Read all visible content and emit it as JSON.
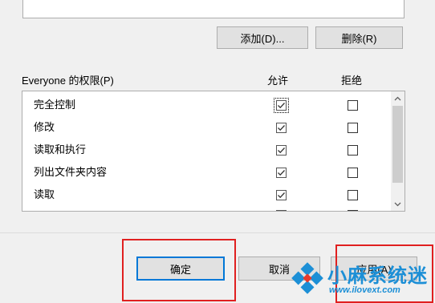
{
  "buttons": {
    "add": "添加(D)...",
    "remove": "删除(R)",
    "ok": "确定",
    "cancel": "取消",
    "apply": "应用(A)"
  },
  "permissions": {
    "title": "Everyone 的权限(P)",
    "col_allow": "允许",
    "col_deny": "拒绝",
    "rows": [
      {
        "label": "完全控制",
        "allow": true,
        "deny": false
      },
      {
        "label": "修改",
        "allow": true,
        "deny": false
      },
      {
        "label": "读取和执行",
        "allow": true,
        "deny": false
      },
      {
        "label": "列出文件夹内容",
        "allow": true,
        "deny": false
      },
      {
        "label": "读取",
        "allow": true,
        "deny": false
      }
    ]
  },
  "watermark": {
    "text": "小麻系统迷",
    "url": "www.ilovext.com"
  },
  "colors": {
    "accent": "#0078d7",
    "highlight": "#e02020"
  }
}
